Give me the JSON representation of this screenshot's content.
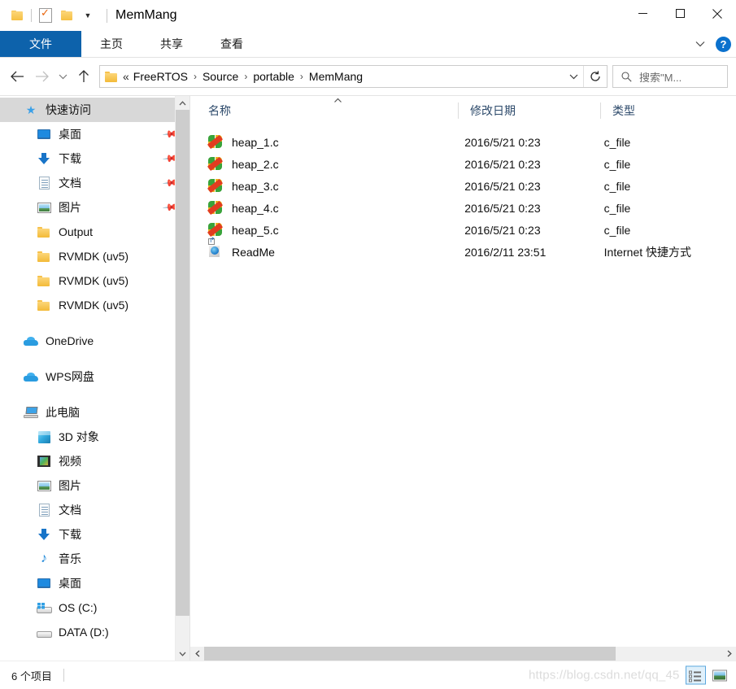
{
  "window": {
    "title": "MemMang",
    "quick_access_toolbar": [
      {
        "name": "folder-icon",
        "tooltip": "属性"
      },
      {
        "name": "properties-icon",
        "tooltip": "属性"
      },
      {
        "name": "new-folder-icon",
        "tooltip": "新建文件夹"
      },
      {
        "name": "customize-caret",
        "label": "▾"
      }
    ],
    "controls": {
      "minimize": "—",
      "maximize": "□",
      "close": "✕"
    }
  },
  "ribbon": {
    "tabs": [
      {
        "label": "文件",
        "active": true
      },
      {
        "label": "主页",
        "active": false
      },
      {
        "label": "共享",
        "active": false
      },
      {
        "label": "查看",
        "active": false
      }
    ],
    "expand_caret": "⌄",
    "help_label": "?"
  },
  "addressbar": {
    "back": "←",
    "forward": "→",
    "recent": "⌄",
    "up": "↑",
    "lead": "«",
    "crumbs": [
      "FreeRTOS",
      "Source",
      "portable",
      "MemMang"
    ],
    "separator": "›",
    "dropdown_caret": "⌄",
    "refresh": "↻"
  },
  "search": {
    "icon": "search-icon",
    "placeholder": "搜索\"M...",
    "value": "搜索\"M..."
  },
  "navpane": {
    "groups": [
      {
        "header": {
          "label": "快速访问",
          "icon": "star-pin-icon",
          "selected": true
        },
        "items": [
          {
            "label": "桌面",
            "icon": "desktop-icon",
            "pinned": true
          },
          {
            "label": "下载",
            "icon": "download-icon",
            "pinned": true
          },
          {
            "label": "文档",
            "icon": "document-icon",
            "pinned": true
          },
          {
            "label": "图片",
            "icon": "pictures-icon",
            "pinned": true
          },
          {
            "label": "Output",
            "icon": "folder-icon",
            "pinned": false
          },
          {
            "label": "RVMDK (uv5)",
            "icon": "folder-icon",
            "pinned": false
          },
          {
            "label": "RVMDK (uv5)",
            "icon": "folder-icon",
            "pinned": false
          },
          {
            "label": "RVMDK (uv5)",
            "icon": "folder-icon",
            "pinned": false
          }
        ]
      },
      {
        "header": {
          "label": "OneDrive",
          "icon": "onedrive-icon",
          "selected": false
        },
        "items": []
      },
      {
        "header": {
          "label": "WPS网盘",
          "icon": "wps-cloud-icon",
          "selected": false
        },
        "items": []
      },
      {
        "header": {
          "label": "此电脑",
          "icon": "this-pc-icon",
          "selected": false
        },
        "items": [
          {
            "label": "3D 对象",
            "icon": "3d-objects-icon",
            "pinned": false
          },
          {
            "label": "视频",
            "icon": "videos-icon",
            "pinned": false
          },
          {
            "label": "图片",
            "icon": "pictures-icon",
            "pinned": false
          },
          {
            "label": "文档",
            "icon": "document-icon",
            "pinned": false
          },
          {
            "label": "下载",
            "icon": "download-icon",
            "pinned": false
          },
          {
            "label": "音乐",
            "icon": "music-icon",
            "pinned": false
          },
          {
            "label": "桌面",
            "icon": "desktop-icon",
            "pinned": false
          },
          {
            "label": "OS (C:)",
            "icon": "os-drive-icon",
            "pinned": false
          },
          {
            "label": "DATA (D:)",
            "icon": "drive-icon",
            "pinned": false
          }
        ]
      }
    ],
    "scroll": {
      "up_arrow": "⌃",
      "down_arrow": "⌄"
    }
  },
  "filelist": {
    "columns": [
      {
        "label": "名称",
        "sorted": true,
        "sort_dir": "asc"
      },
      {
        "label": "修改日期",
        "sorted": false,
        "sort_dir": ""
      },
      {
        "label": "类型",
        "sorted": false,
        "sort_dir": ""
      }
    ],
    "sort_caret": "⌃",
    "rows": [
      {
        "name": "heap_1.c",
        "date": "2016/5/21 0:23",
        "type": "c_file",
        "icon": "c-source-icon"
      },
      {
        "name": "heap_2.c",
        "date": "2016/5/21 0:23",
        "type": "c_file",
        "icon": "c-source-icon"
      },
      {
        "name": "heap_3.c",
        "date": "2016/5/21 0:23",
        "type": "c_file",
        "icon": "c-source-icon"
      },
      {
        "name": "heap_4.c",
        "date": "2016/5/21 0:23",
        "type": "c_file",
        "icon": "c-source-icon"
      },
      {
        "name": "heap_5.c",
        "date": "2016/5/21 0:23",
        "type": "c_file",
        "icon": "c-source-icon"
      },
      {
        "name": "ReadMe",
        "date": "2016/2/11 23:51",
        "type": "Internet 快捷方式",
        "icon": "internet-shortcut-icon"
      }
    ],
    "hscroll": {
      "left_arrow": "‹",
      "right_arrow": "›"
    }
  },
  "statusbar": {
    "item_count": "6 个项目",
    "watermark": "https://blog.csdn.net/qq_45",
    "views": [
      {
        "name": "details-view-button",
        "active": true
      },
      {
        "name": "large-icons-view-button",
        "active": false
      }
    ]
  },
  "colors": {
    "accent": "#0d62ab",
    "help_blue": "#0b71cd",
    "selection_gray": "#d8d8d8",
    "column_header_text": "#2d4a6b",
    "scroll_thumb": "#cdcdcd",
    "view_active_border": "#5ba7dd"
  }
}
